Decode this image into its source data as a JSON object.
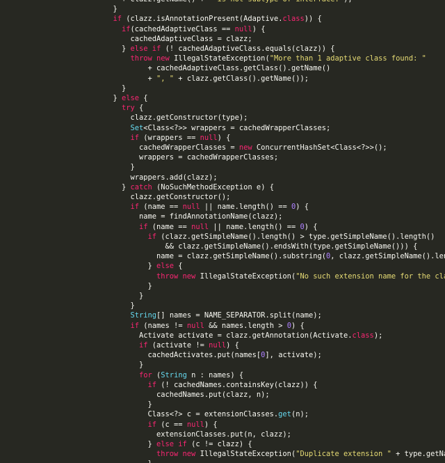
{
  "editor": {
    "background": "#272822",
    "token_colors": {
      "kw": "#f92672",
      "ty": "#66d9ef",
      "str": "#e6db74",
      "num": "#ae81ff",
      "pl": "#f8f8f2"
    },
    "lines": [
      {
        "indent": 28,
        "tokens": [
          [
            "pl",
            "+ clazz.getName() + "
          ],
          [
            "str",
            "\" is not subtype of interface.\""
          ],
          [
            "pl",
            ");"
          ]
        ]
      },
      {
        "indent": 26,
        "tokens": [
          [
            "pl",
            "}"
          ]
        ]
      },
      {
        "indent": 26,
        "tokens": [
          [
            "kw",
            "if"
          ],
          [
            "pl",
            " (clazz.isAnnotationPresent(Adaptive."
          ],
          [
            "kw",
            "class"
          ],
          [
            "pl",
            ")) {"
          ]
        ]
      },
      {
        "indent": 28,
        "tokens": [
          [
            "kw",
            "if"
          ],
          [
            "pl",
            "(cachedAdaptiveClass == "
          ],
          [
            "kw",
            "null"
          ],
          [
            "pl",
            ") {"
          ]
        ]
      },
      {
        "indent": 30,
        "tokens": [
          [
            "pl",
            "cachedAdaptiveClass = clazz;"
          ]
        ]
      },
      {
        "indent": 28,
        "tokens": [
          [
            "pl",
            "} "
          ],
          [
            "kw",
            "else if"
          ],
          [
            "pl",
            " (! cachedAdaptiveClass.equals(clazz)) {"
          ]
        ]
      },
      {
        "indent": 30,
        "tokens": [
          [
            "kw",
            "throw new"
          ],
          [
            "pl",
            " IllegalStateException("
          ],
          [
            "str",
            "\"More than 1 adaptive class found: \""
          ]
        ]
      },
      {
        "indent": 34,
        "tokens": [
          [
            "pl",
            "+ cachedAdaptiveClass.getClass().getName()"
          ]
        ]
      },
      {
        "indent": 34,
        "tokens": [
          [
            "pl",
            "+ "
          ],
          [
            "str",
            "\", \""
          ],
          [
            "pl",
            " + clazz.getClass().getName());"
          ]
        ]
      },
      {
        "indent": 28,
        "tokens": [
          [
            "pl",
            "}"
          ]
        ]
      },
      {
        "indent": 26,
        "tokens": [
          [
            "pl",
            "} "
          ],
          [
            "kw",
            "else"
          ],
          [
            "pl",
            " {"
          ]
        ]
      },
      {
        "indent": 28,
        "tokens": [
          [
            "kw",
            "try"
          ],
          [
            "pl",
            " {"
          ]
        ]
      },
      {
        "indent": 30,
        "tokens": [
          [
            "pl",
            "clazz.getConstructor(type);"
          ]
        ]
      },
      {
        "indent": 30,
        "tokens": [
          [
            "ty",
            "Set"
          ],
          [
            "pl",
            "<Class<?>> wrappers = cachedWrapperClasses;"
          ]
        ]
      },
      {
        "indent": 30,
        "tokens": [
          [
            "kw",
            "if"
          ],
          [
            "pl",
            " (wrappers == "
          ],
          [
            "kw",
            "null"
          ],
          [
            "pl",
            ") {"
          ]
        ]
      },
      {
        "indent": 32,
        "tokens": [
          [
            "pl",
            "cachedWrapperClasses = "
          ],
          [
            "kw",
            "new"
          ],
          [
            "pl",
            " ConcurrentHashSet<Class<?>>();"
          ]
        ]
      },
      {
        "indent": 32,
        "tokens": [
          [
            "pl",
            "wrappers = cachedWrapperClasses;"
          ]
        ]
      },
      {
        "indent": 30,
        "tokens": [
          [
            "pl",
            "}"
          ]
        ]
      },
      {
        "indent": 30,
        "tokens": [
          [
            "pl",
            "wrappers.add(clazz);"
          ]
        ]
      },
      {
        "indent": 28,
        "tokens": [
          [
            "pl",
            "} "
          ],
          [
            "kw",
            "catch"
          ],
          [
            "pl",
            " (NoSuchMethodException e) {"
          ]
        ]
      },
      {
        "indent": 30,
        "tokens": [
          [
            "pl",
            "clazz.getConstructor();"
          ]
        ]
      },
      {
        "indent": 30,
        "tokens": [
          [
            "kw",
            "if"
          ],
          [
            "pl",
            " (name == "
          ],
          [
            "kw",
            "null"
          ],
          [
            "pl",
            " || name.length() == "
          ],
          [
            "num",
            "0"
          ],
          [
            "pl",
            ") {"
          ]
        ]
      },
      {
        "indent": 32,
        "tokens": [
          [
            "pl",
            "name = findAnnotationName(clazz);"
          ]
        ]
      },
      {
        "indent": 32,
        "tokens": [
          [
            "kw",
            "if"
          ],
          [
            "pl",
            " (name == "
          ],
          [
            "kw",
            "null"
          ],
          [
            "pl",
            " || name.length() == "
          ],
          [
            "num",
            "0"
          ],
          [
            "pl",
            ") {"
          ]
        ]
      },
      {
        "indent": 34,
        "tokens": [
          [
            "kw",
            "if"
          ],
          [
            "pl",
            " (clazz.getSimpleName().length() > type.getSimpleName().length()"
          ]
        ]
      },
      {
        "indent": 38,
        "tokens": [
          [
            "pl",
            "&& clazz.getSimpleName().endsWith(type.getSimpleName())) {"
          ]
        ]
      },
      {
        "indent": 36,
        "tokens": [
          [
            "pl",
            "name = clazz.getSimpleName().substring("
          ],
          [
            "num",
            "0"
          ],
          [
            "pl",
            ", clazz.getSimpleName().length"
          ]
        ]
      },
      {
        "indent": 34,
        "tokens": [
          [
            "pl",
            "} "
          ],
          [
            "kw",
            "else"
          ],
          [
            "pl",
            " {"
          ]
        ]
      },
      {
        "indent": 36,
        "tokens": [
          [
            "kw",
            "throw new"
          ],
          [
            "pl",
            " IllegalStateException("
          ],
          [
            "str",
            "\"No such extension name for the class \""
          ]
        ]
      },
      {
        "indent": 34,
        "tokens": [
          [
            "pl",
            "}"
          ]
        ]
      },
      {
        "indent": 32,
        "tokens": [
          [
            "pl",
            "}"
          ]
        ]
      },
      {
        "indent": 30,
        "tokens": [
          [
            "pl",
            "}"
          ]
        ]
      },
      {
        "indent": 30,
        "tokens": [
          [
            "ty",
            "String"
          ],
          [
            "pl",
            "[] names = NAME_SEPARATOR.split(name);"
          ]
        ]
      },
      {
        "indent": 30,
        "tokens": [
          [
            "kw",
            "if"
          ],
          [
            "pl",
            " (names != "
          ],
          [
            "kw",
            "null"
          ],
          [
            "pl",
            " && names.length > "
          ],
          [
            "num",
            "0"
          ],
          [
            "pl",
            ") {"
          ]
        ]
      },
      {
        "indent": 32,
        "tokens": [
          [
            "pl",
            "Activate activate = clazz.getAnnotation(Activate."
          ],
          [
            "kw",
            "class"
          ],
          [
            "pl",
            ");"
          ]
        ]
      },
      {
        "indent": 32,
        "tokens": [
          [
            "kw",
            "if"
          ],
          [
            "pl",
            " (activate != "
          ],
          [
            "kw",
            "null"
          ],
          [
            "pl",
            ") {"
          ]
        ]
      },
      {
        "indent": 34,
        "tokens": [
          [
            "pl",
            "cachedActivates.put(names["
          ],
          [
            "num",
            "0"
          ],
          [
            "pl",
            "], activate);"
          ]
        ]
      },
      {
        "indent": 32,
        "tokens": [
          [
            "pl",
            "}"
          ]
        ]
      },
      {
        "indent": 32,
        "tokens": [
          [
            "kw",
            "for"
          ],
          [
            "pl",
            " ("
          ],
          [
            "ty",
            "String"
          ],
          [
            "pl",
            " n : names) {"
          ]
        ]
      },
      {
        "indent": 34,
        "tokens": [
          [
            "kw",
            "if"
          ],
          [
            "pl",
            " (! cachedNames.containsKey(clazz)) {"
          ]
        ]
      },
      {
        "indent": 36,
        "tokens": [
          [
            "pl",
            "cachedNames.put(clazz, n);"
          ]
        ]
      },
      {
        "indent": 34,
        "tokens": [
          [
            "pl",
            "}"
          ]
        ]
      },
      {
        "indent": 34,
        "tokens": [
          [
            "pl",
            "Class<?> c = extensionClasses."
          ],
          [
            "ty",
            "get"
          ],
          [
            "pl",
            "(n);"
          ]
        ]
      },
      {
        "indent": 34,
        "tokens": [
          [
            "kw",
            "if"
          ],
          [
            "pl",
            " (c == "
          ],
          [
            "kw",
            "null"
          ],
          [
            "pl",
            ") {"
          ]
        ]
      },
      {
        "indent": 36,
        "tokens": [
          [
            "pl",
            "extensionClasses.put(n, clazz);"
          ]
        ]
      },
      {
        "indent": 34,
        "tokens": [
          [
            "pl",
            "} "
          ],
          [
            "kw",
            "else if"
          ],
          [
            "pl",
            " (c != clazz) {"
          ]
        ]
      },
      {
        "indent": 36,
        "tokens": [
          [
            "kw",
            "throw new"
          ],
          [
            "pl",
            " IllegalStateException("
          ],
          [
            "str",
            "\"Duplicate extension \""
          ],
          [
            "pl",
            " + type.getName"
          ]
        ]
      },
      {
        "indent": 34,
        "tokens": [
          [
            "pl",
            "}"
          ]
        ]
      }
    ]
  }
}
